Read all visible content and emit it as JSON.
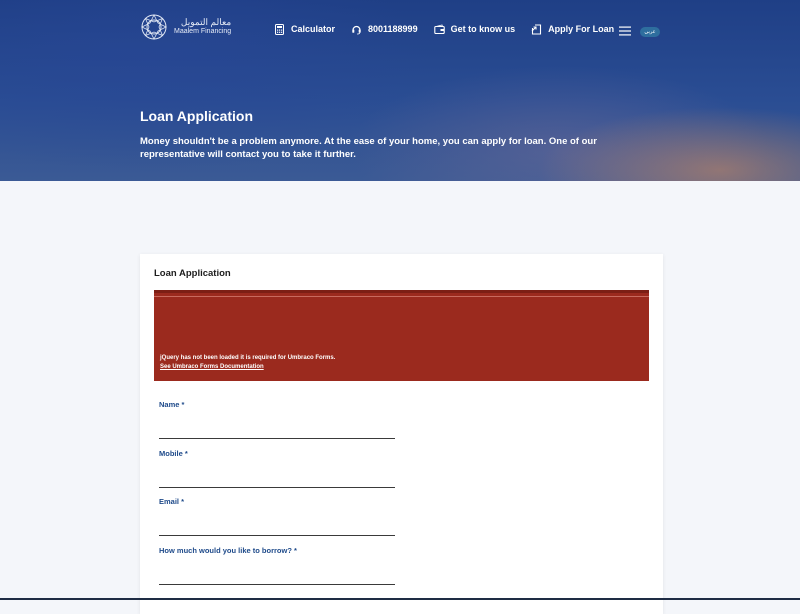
{
  "logo": {
    "arabic_name": "معالم التمويل",
    "english_name": "Maalem Financing"
  },
  "nav": {
    "items": [
      {
        "label": "Calculator",
        "icon": "calculator-icon"
      },
      {
        "label": "8001188999",
        "icon": "headset-icon"
      },
      {
        "label": "Get to know us",
        "icon": "wallet-icon"
      },
      {
        "label": "Apply For Loan",
        "icon": "apply-icon"
      }
    ],
    "language": "عربي"
  },
  "hero": {
    "title": "Loan Application",
    "description": "Money shouldn't be a problem anymore. At the ease of your home, you can apply for loan. One of our representative will contact you to take it further."
  },
  "form": {
    "title": "Loan Application",
    "error_message": "jQuery has not been loaded it is required for Umbraco Forms.",
    "error_link": "See Umbraco Forms Documentation",
    "fields": [
      {
        "label": "Name *",
        "value": ""
      },
      {
        "label": "Mobile *",
        "value": ""
      },
      {
        "label": "Email *",
        "value": ""
      },
      {
        "label": "How much would you like to borrow? *",
        "value": ""
      }
    ]
  },
  "colors": {
    "hero_blue": "#1f3f86",
    "error_red": "#9b2a1e",
    "label_blue": "#1e4a8a"
  }
}
